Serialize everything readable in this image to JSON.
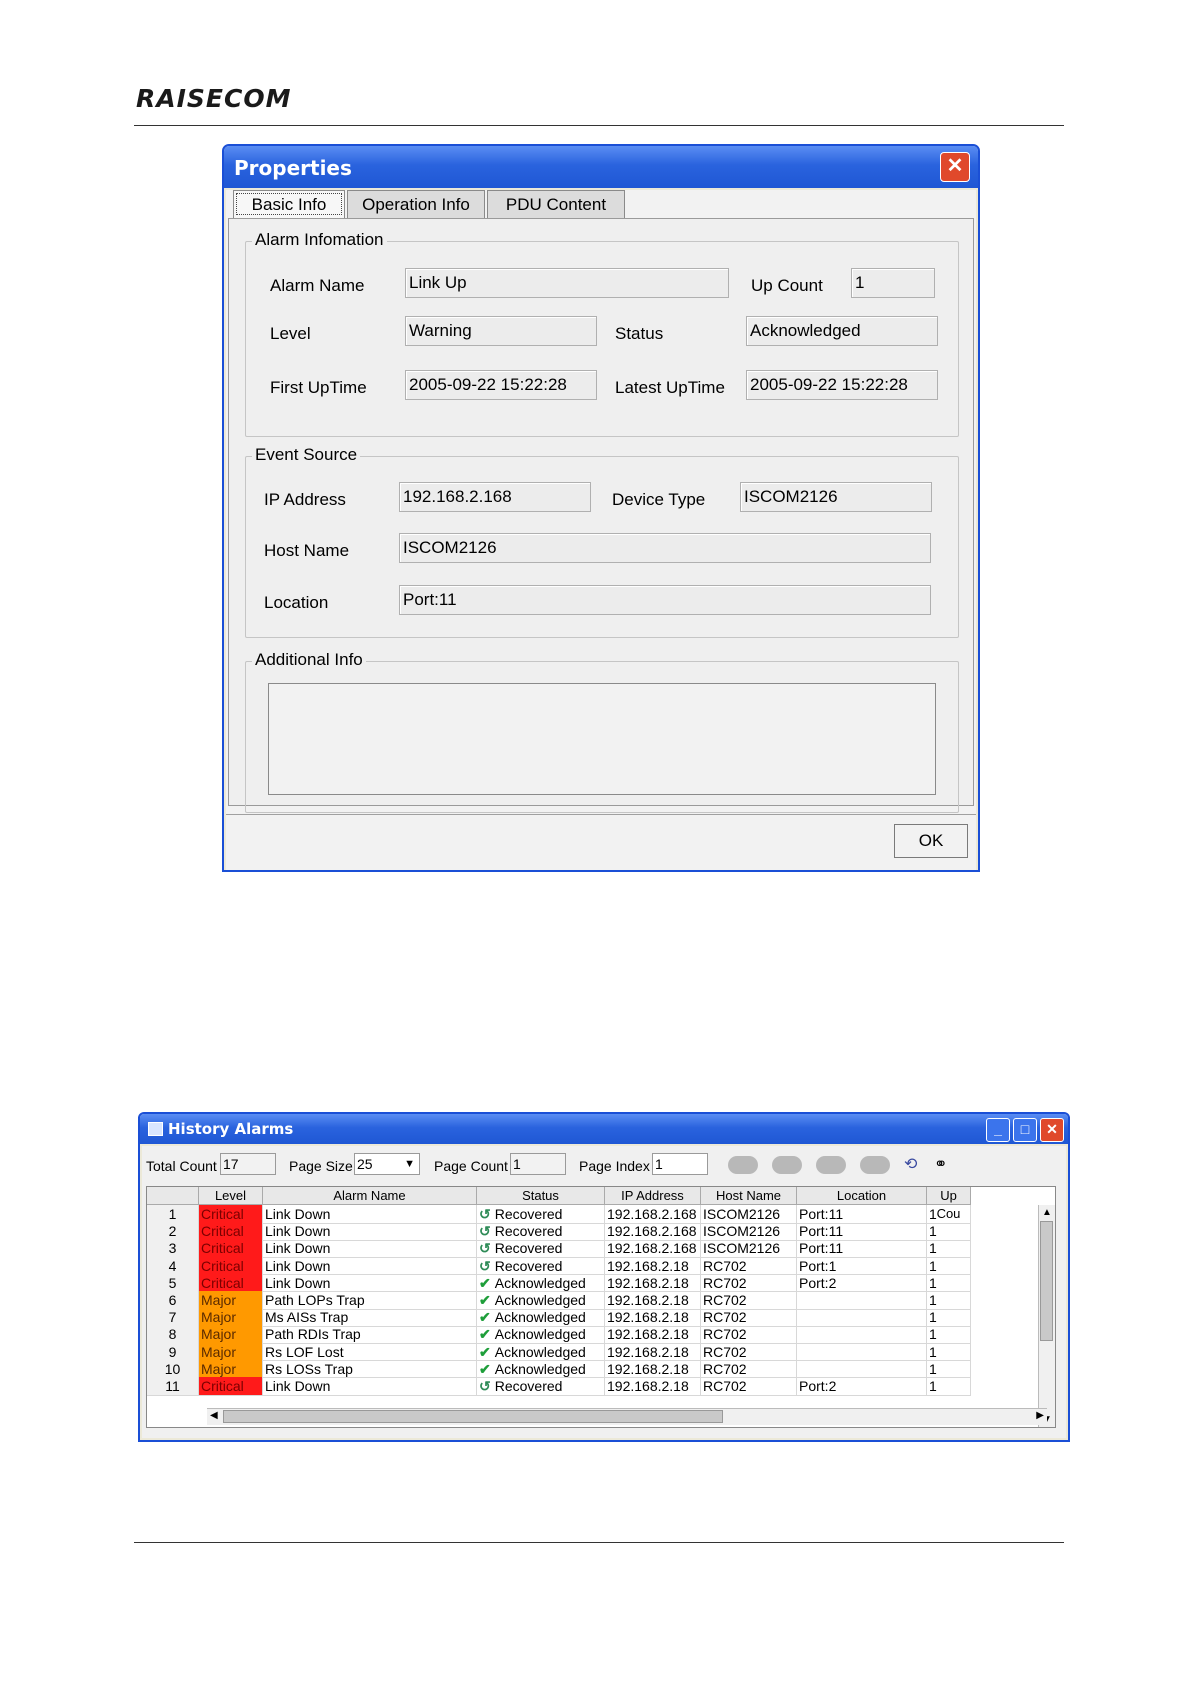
{
  "header": {
    "logo_text": "RAISECOM"
  },
  "properties_dialog": {
    "title": "Properties",
    "tabs": [
      {
        "label": "Basic Info",
        "active": true
      },
      {
        "label": "Operation Info",
        "active": false
      },
      {
        "label": "PDU Content",
        "active": false
      }
    ],
    "alarm_information": {
      "legend": "Alarm Infomation",
      "alarm_name_label": "Alarm Name",
      "alarm_name_value": "Link Up",
      "up_count_label": "Up Count",
      "up_count_value": "1",
      "level_label": "Level",
      "level_value": "Warning",
      "status_label": "Status",
      "status_value": "Acknowledged",
      "first_uptime_label": "First UpTime",
      "first_uptime_value": "2005-09-22 15:22:28",
      "latest_uptime_label": "Latest UpTime",
      "latest_uptime_value": "2005-09-22 15:22:28"
    },
    "event_source": {
      "legend": "Event Source",
      "ip_label": "IP Address",
      "ip_value": "192.168.2.168",
      "device_type_label": "Device Type",
      "device_type_value": "ISCOM2126",
      "host_name_label": "Host Name",
      "host_name_value": "ISCOM2126",
      "location_label": "Location",
      "location_value": "Port:11"
    },
    "additional_info": {
      "legend": "Additional Info",
      "value": ""
    },
    "ok_label": "OK"
  },
  "history_window": {
    "title": "History Alarms",
    "toolbar": {
      "total_count_label": "Total Count",
      "total_count_value": "17",
      "page_size_label": "Page Size",
      "page_size_value": "25",
      "page_count_label": "Page Count",
      "page_count_value": "1",
      "page_index_label": "Page Index",
      "page_index_value": "1"
    },
    "columns": [
      "",
      "Level",
      "Alarm Name",
      "Status",
      "IP Address",
      "Host Name",
      "Location",
      "Up Cou"
    ],
    "colors": {
      "critical": "#ff1a1a",
      "major": "#ff9900",
      "recovered_icon": "#2e8b57",
      "ack_icon": "#1e9e3a"
    },
    "rows": [
      {
        "num": "1",
        "level": "Critical",
        "alarm": "Link Down",
        "status_icon": "recovered-icon",
        "status": "Recovered",
        "ip": "192.168.2.168",
        "host": "ISCOM2126",
        "location": "Port:11",
        "up": "1"
      },
      {
        "num": "2",
        "level": "Critical",
        "alarm": "Link Down",
        "status_icon": "recovered-icon",
        "status": "Recovered",
        "ip": "192.168.2.168",
        "host": "ISCOM2126",
        "location": "Port:11",
        "up": "1"
      },
      {
        "num": "3",
        "level": "Critical",
        "alarm": "Link Down",
        "status_icon": "recovered-icon",
        "status": "Recovered",
        "ip": "192.168.2.168",
        "host": "ISCOM2126",
        "location": "Port:11",
        "up": "1"
      },
      {
        "num": "4",
        "level": "Critical",
        "alarm": "Link Down",
        "status_icon": "recovered-icon",
        "status": "Recovered",
        "ip": "192.168.2.18",
        "host": "RC702",
        "location": "Port:1",
        "up": "1"
      },
      {
        "num": "5",
        "level": "Critical",
        "alarm": "Link Down",
        "status_icon": "acknowledged-icon",
        "status": "Acknowledged",
        "ip": "192.168.2.18",
        "host": "RC702",
        "location": "Port:2",
        "up": "1"
      },
      {
        "num": "6",
        "level": "Major",
        "alarm": "Path LOPs Trap",
        "status_icon": "acknowledged-icon",
        "status": "Acknowledged",
        "ip": "192.168.2.18",
        "host": "RC702",
        "location": "",
        "up": "1"
      },
      {
        "num": "7",
        "level": "Major",
        "alarm": "Ms AISs Trap",
        "status_icon": "acknowledged-icon",
        "status": "Acknowledged",
        "ip": "192.168.2.18",
        "host": "RC702",
        "location": "",
        "up": "1"
      },
      {
        "num": "8",
        "level": "Major",
        "alarm": "Path RDIs Trap",
        "status_icon": "acknowledged-icon",
        "status": "Acknowledged",
        "ip": "192.168.2.18",
        "host": "RC702",
        "location": "",
        "up": "1"
      },
      {
        "num": "9",
        "level": "Major",
        "alarm": "Rs LOF Lost",
        "status_icon": "acknowledged-icon",
        "status": "Acknowledged",
        "ip": "192.168.2.18",
        "host": "RC702",
        "location": "",
        "up": "1"
      },
      {
        "num": "10",
        "level": "Major",
        "alarm": "Rs LOSs Trap",
        "status_icon": "acknowledged-icon",
        "status": "Acknowledged",
        "ip": "192.168.2.18",
        "host": "RC702",
        "location": "",
        "up": "1"
      },
      {
        "num": "11",
        "level": "Critical",
        "alarm": "Link Down",
        "status_icon": "recovered-icon",
        "status": "Recovered",
        "ip": "192.168.2.18",
        "host": "RC702",
        "location": "Port:2",
        "up": "1"
      }
    ]
  }
}
